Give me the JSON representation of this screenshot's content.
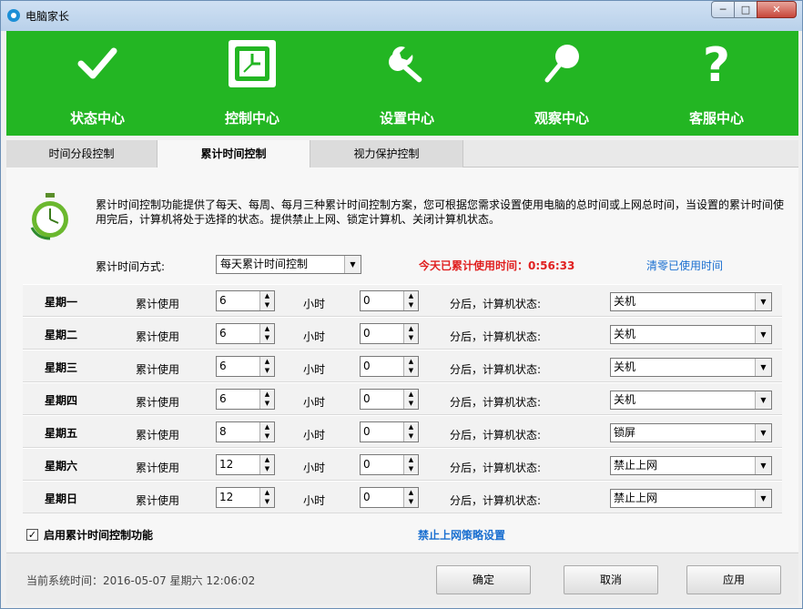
{
  "window": {
    "title": "电脑家长"
  },
  "nav": [
    {
      "label": "状态中心",
      "icon": "checkmark-icon",
      "active": false
    },
    {
      "label": "控制中心",
      "icon": "clock-icon",
      "active": true
    },
    {
      "label": "设置中心",
      "icon": "wrench-icon",
      "active": false
    },
    {
      "label": "观察中心",
      "icon": "magnifier-icon",
      "active": false
    },
    {
      "label": "客服中心",
      "icon": "question-icon",
      "active": false
    }
  ],
  "subtabs": [
    "时间分段控制",
    "累计时间控制",
    "视力保护控制"
  ],
  "description": "累计时间控制功能提供了每天、每周、每月三种累计时间控制方案，您可根据您需求设置使用电脑的总时间或上网总时间，当设置的累计时间使用完后，计算机将处于选择的状态。提供禁止上网、锁定计算机、关闭计算机状态。",
  "mode": {
    "label": "累计时间方式:",
    "value": "每天累计时间控制"
  },
  "today_used": "今天已累计使用时间：0:56:33",
  "reset_link": "清零已使用时间",
  "row_labels": {
    "cumulative": "累计使用",
    "hours": "小时",
    "after": "分后，计算机状态:"
  },
  "days": [
    {
      "day": "星期一",
      "hours": "6",
      "minutes": "0",
      "status": "关机"
    },
    {
      "day": "星期二",
      "hours": "6",
      "minutes": "0",
      "status": "关机"
    },
    {
      "day": "星期三",
      "hours": "6",
      "minutes": "0",
      "status": "关机"
    },
    {
      "day": "星期四",
      "hours": "6",
      "minutes": "0",
      "status": "关机"
    },
    {
      "day": "星期五",
      "hours": "8",
      "minutes": "0",
      "status": "锁屏"
    },
    {
      "day": "星期六",
      "hours": "12",
      "minutes": "0",
      "status": "禁止上网"
    },
    {
      "day": "星期日",
      "hours": "12",
      "minutes": "0",
      "status": "禁止上网"
    }
  ],
  "enable": {
    "checked": true,
    "label": "启用累计时间控制功能"
  },
  "policy_link": "禁止上网策略设置",
  "footer": {
    "system_time": "当前系统时间：2016-05-07 星期六 12:06:02",
    "ok": "确定",
    "cancel": "取消",
    "apply": "应用"
  },
  "colors": {
    "banner": "#23b623",
    "alert": "#e02020",
    "link": "#1a6fd0"
  }
}
